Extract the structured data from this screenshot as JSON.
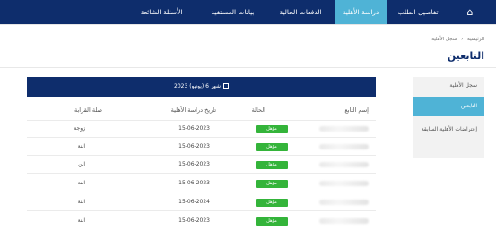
{
  "nav": {
    "items": [
      {
        "label": "تفاصيل الطلب"
      },
      {
        "label": "دراسة الأهلية"
      },
      {
        "label": "الدفعات الحالية"
      },
      {
        "label": "بيانات المستفيد"
      },
      {
        "label": "الأسئلة الشائعة"
      }
    ],
    "home_icon": "home-icon"
  },
  "breadcrumb": [
    "الرئيسية",
    "سجل الأهلية"
  ],
  "page_title": "التابعين",
  "sidebar": {
    "items": [
      {
        "label": "سجل الأهلية"
      },
      {
        "label": "التابعين"
      },
      {
        "label": "إعتراضات الأهلية السابقة"
      }
    ]
  },
  "table": {
    "period_label": "شهر 6 (يونيو) 2023",
    "columns": [
      "إسم التابع",
      "الحالة",
      "تاريخ دراسة الأهلية",
      "صلة القرابة"
    ],
    "rows": [
      {
        "status": "مؤهل",
        "date": "15-06-2023",
        "relation": "زوجة"
      },
      {
        "status": "مؤهل",
        "date": "15-06-2023",
        "relation": "ابنة"
      },
      {
        "status": "مؤهل",
        "date": "15-06-2023",
        "relation": "ابن"
      },
      {
        "status": "مؤهل",
        "date": "15-06-2023",
        "relation": "ابنة"
      },
      {
        "status": "مؤهل",
        "date": "15-06-2024",
        "relation": "ابنة"
      },
      {
        "status": "مؤهل",
        "date": "15-06-2023",
        "relation": "ابنة"
      }
    ]
  },
  "colors": {
    "nav_bg": "#0e2d6c",
    "accent": "#4fb3d6",
    "status_green": "#34b43a"
  }
}
